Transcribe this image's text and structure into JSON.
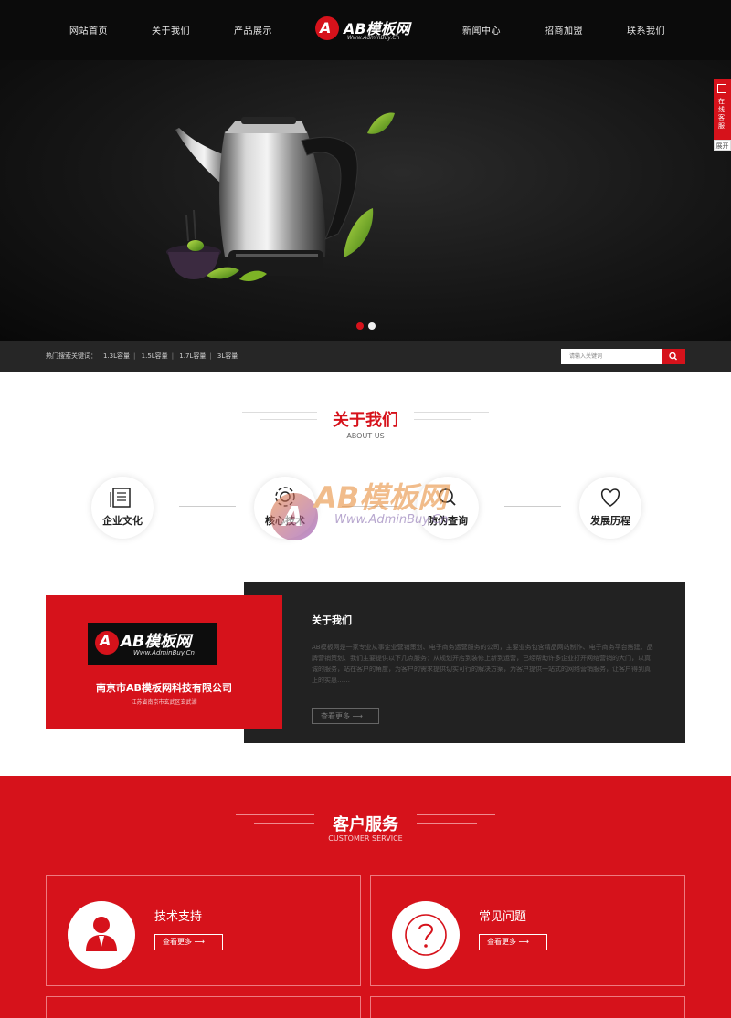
{
  "nav": {
    "items": [
      "网站首页",
      "关于我们",
      "产品展示",
      "新闻中心",
      "招商加盟",
      "联系我们"
    ],
    "logo_text": "AB模板网",
    "logo_sub": "Www.AdminBuy.Cn"
  },
  "side": {
    "text": "在线客服",
    "close": "展开"
  },
  "keywords": {
    "label": "热门搜索关键词：",
    "items": [
      "1.3L容量",
      "1.5L容量",
      "1.7L容量",
      "3L容量"
    ],
    "search_placeholder": "请输入关键词"
  },
  "about": {
    "title": "关于我们",
    "subtitle": "ABOUT US",
    "features": [
      "企业文化",
      "核心技术",
      "防伪查询",
      "发展历程"
    ]
  },
  "watermark": {
    "text": "AB模板网",
    "sub": "Www.AdminBuy.Cn"
  },
  "company": {
    "logo_text": "AB模板网",
    "logo_sub": "Www.AdminBuy.Cn",
    "name": "南京市AB模板网科技有限公司",
    "address": "江苏省南京市玄武区玄武湖",
    "heading": "关于我们",
    "body": "AB模板网是一家专业从事企业营销策划、电子商务运营服务的公司，主要业务包含精品网站制作、电子商务平台搭建、品牌营销策划、我们主要提供以下几点服务：从规划开店到装修上新到运营，已经帮助许多企业打开网络营销的大门，以真诚的服务，站在客户的角度，为客户的需求提供切实可行的解决方案，为客户提供一站式的网络营销服务，让客户得到真正的实惠……",
    "more": "查看更多"
  },
  "service": {
    "title": "客户服务",
    "subtitle": "CUSTOMER SERVICE",
    "cards": [
      {
        "title": "技术支持",
        "more": "查看更多"
      },
      {
        "title": "常见问题",
        "more": "查看更多"
      }
    ]
  },
  "colors": {
    "accent": "#d6121b",
    "dark": "#0b0b0b",
    "panel": "#222222"
  }
}
